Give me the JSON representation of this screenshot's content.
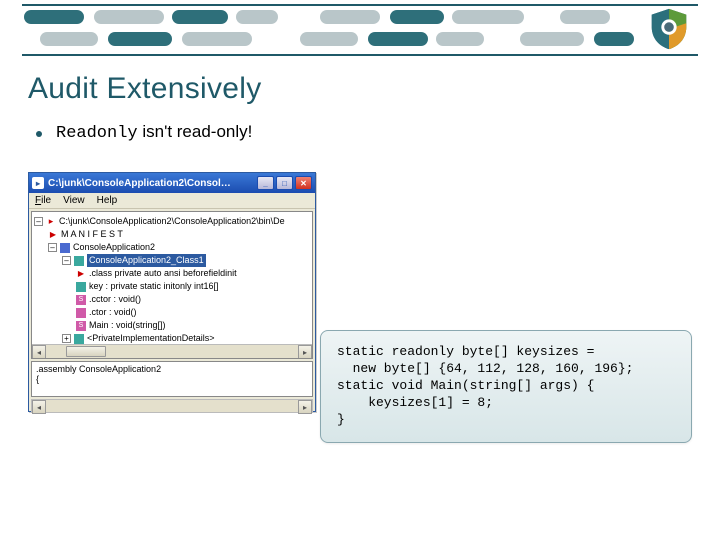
{
  "slide": {
    "title": "Audit Extensively",
    "bullet_mono": "Readonly",
    "bullet_rest": " isn't read-only!"
  },
  "window": {
    "title": "C:\\junk\\ConsoleApplication2\\Consol…",
    "menu": {
      "file": "File",
      "view": "View",
      "help": "Help"
    },
    "tree": {
      "root": "C:\\junk\\ConsoleApplication2\\ConsoleApplication2\\bin\\De",
      "manifest": "M A N I F E S T",
      "ns": "ConsoleApplication2",
      "cls_sel": "ConsoleApplication2_Class1",
      "cls_meta": ".class private auto ansi beforefieldinit",
      "field": "key : private static initonly int16[]",
      "cctor": ".cctor : void()",
      "ctor": ".ctor : void()",
      "main": "Main : void(string[])",
      "priv": "<PrivateImplementationDetails>"
    },
    "lower": {
      "l1": ".assembly ConsoleApplication2",
      "l2": "{"
    }
  },
  "code": {
    "l1a": "static readonly byte[] keysizes =",
    "l2": "  new byte[] {64, 112, 128, 160, 196};",
    "l3": "static void Main(string[] args) {",
    "l4": "    keysizes[1] = 8;",
    "l5": "}"
  }
}
